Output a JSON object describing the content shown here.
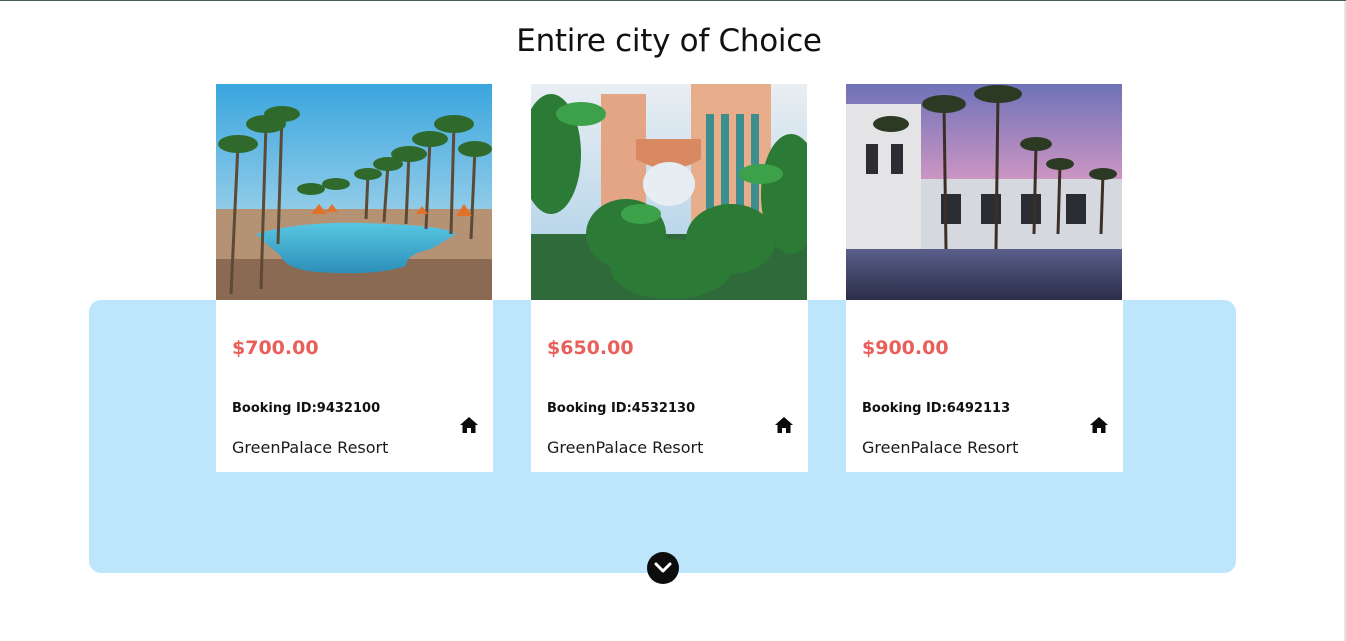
{
  "section": {
    "title": "Entire city of Choice"
  },
  "cards": [
    {
      "image": "palm-pool-resort-photo",
      "price": "$700.00",
      "booking_label": "Booking ID:",
      "booking_id": "9432100",
      "resort_name": "GreenPalace Resort",
      "icon": "home-icon"
    },
    {
      "image": "tropical-tower-resort-photo",
      "price": "$650.00",
      "booking_label": "Booking ID:",
      "booking_id": "4532130",
      "resort_name": "GreenPalace Resort",
      "icon": "home-icon"
    },
    {
      "image": "sunset-pool-villa-photo",
      "price": "$900.00",
      "booking_label": "Booking ID:",
      "booking_id": "6492113",
      "resort_name": "GreenPalace Resort",
      "icon": "home-icon"
    }
  ],
  "expand": {
    "icon": "chevron-down-icon"
  },
  "colors": {
    "price": "#e9605a",
    "band": "#bde5fc",
    "button": "#0d0d0d"
  }
}
